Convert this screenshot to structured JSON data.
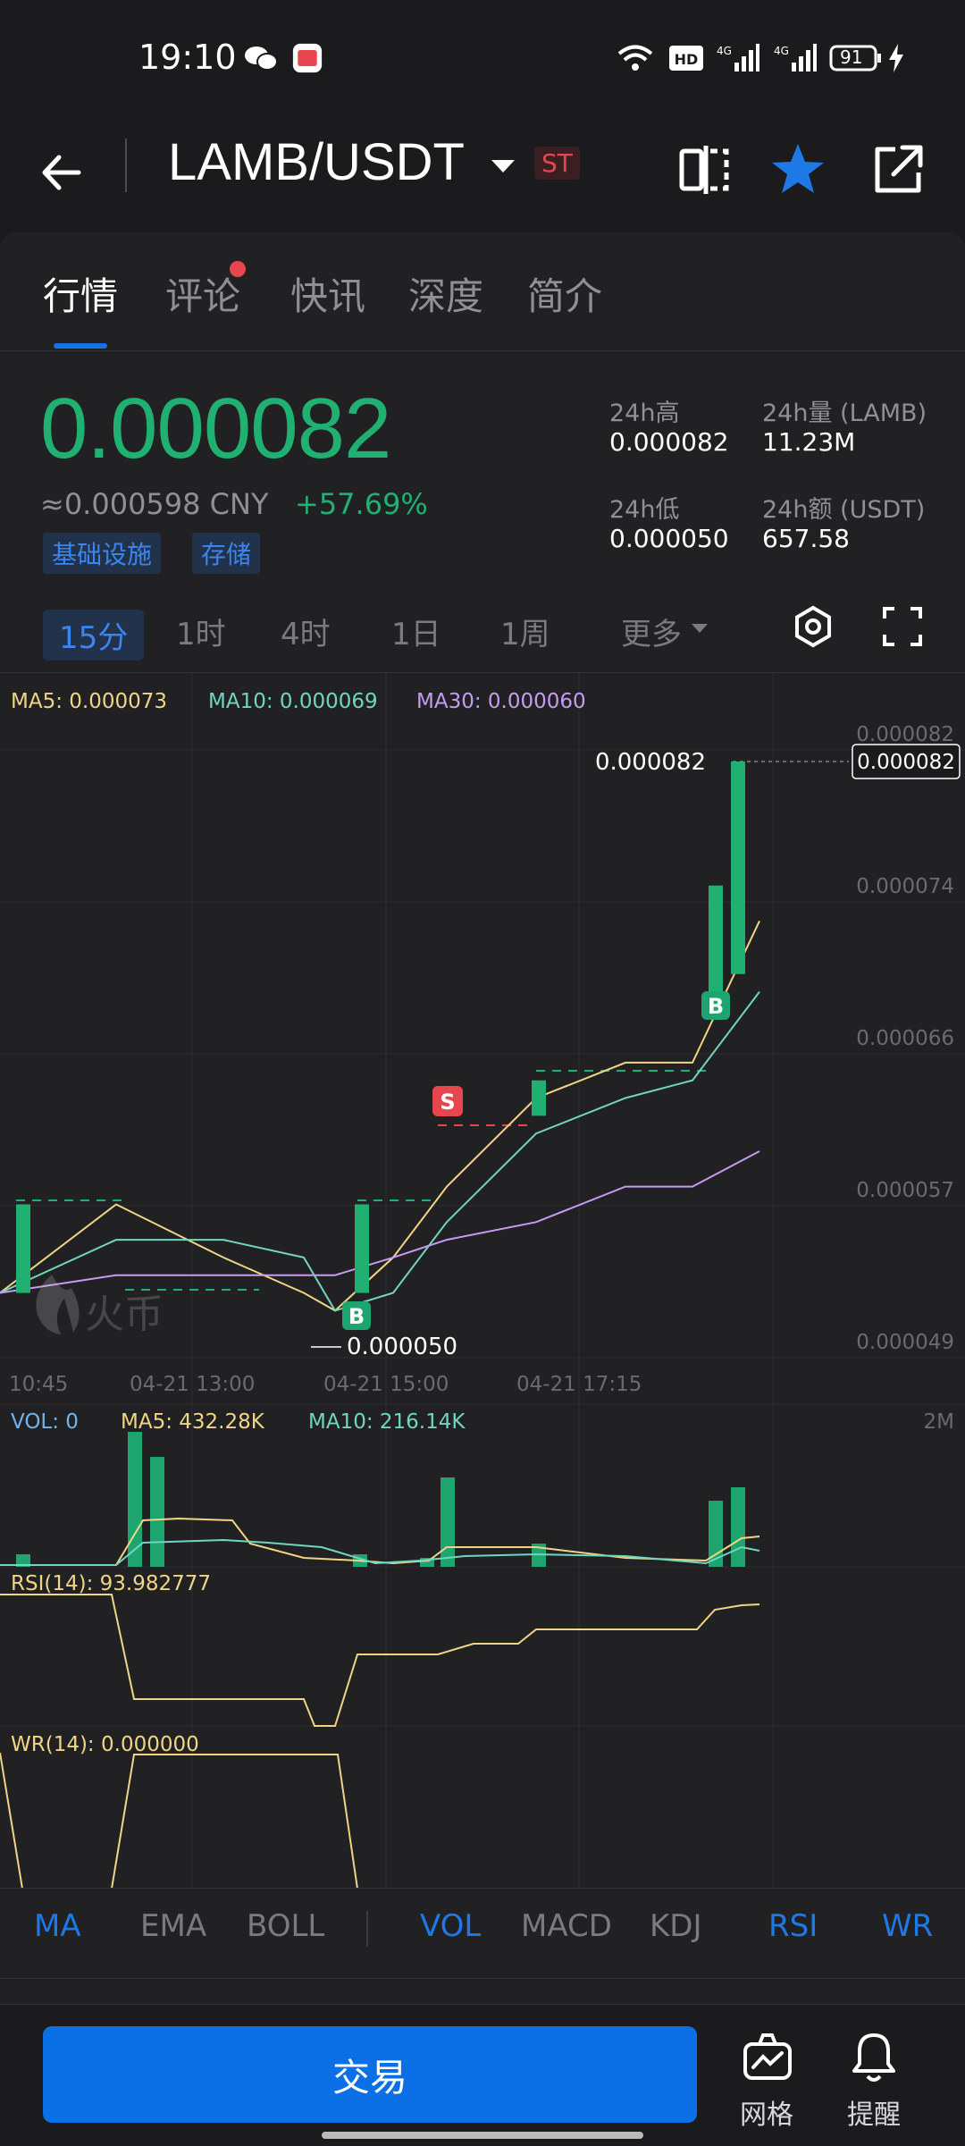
{
  "status_bar": {
    "time": "19:10",
    "battery": "91"
  },
  "header": {
    "pair": "LAMB/USDT",
    "badge": "ST"
  },
  "tabs": [
    "行情",
    "评论",
    "快讯",
    "深度",
    "简介"
  ],
  "ticker": {
    "price": "0.000082",
    "cny": "≈0.000598 CNY",
    "change": "+57.69%",
    "tags": [
      "基础设施",
      "存储"
    ],
    "stats": {
      "high_label": "24h高",
      "high": "0.000082",
      "vol_label": "24h量 (LAMB)",
      "vol": "11.23M",
      "low_label": "24h低",
      "low": "0.000050",
      "amount_label": "24h额 (USDT)",
      "amount": "657.58"
    }
  },
  "timeframes": [
    "15分",
    "1时",
    "4时",
    "1日",
    "1周",
    "更多"
  ],
  "legend": {
    "ma5": "MA5: 0.000073",
    "ma10": "MA10: 0.000069",
    "ma30": "MA30: 0.000060"
  },
  "price_axis": [
    "0.000082",
    "0.000074",
    "0.000066",
    "0.000057",
    "0.000049"
  ],
  "markers": {
    "current": "0.000082",
    "high": "0.000082",
    "low": "0.000050",
    "buy": "B",
    "sell": "S"
  },
  "time_axis": [
    "10:45",
    "04-21 13:00",
    "04-21 15:00",
    "04-21 17:15"
  ],
  "watermark": "火币",
  "vol_legend": {
    "vol": "VOL: 0",
    "ma5": "MA5: 432.28K",
    "ma10": "MA10: 216.14K",
    "max": "2M"
  },
  "rsi_legend": "RSI(14): 93.982777",
  "wr_legend": "WR(14): 0.000000",
  "indicators_main": [
    "MA",
    "EMA",
    "BOLL"
  ],
  "indicators_sub": [
    "VOL",
    "MACD",
    "KDJ",
    "RSI",
    "WR"
  ],
  "bottom": {
    "trade": "交易",
    "grid": "网格",
    "alert": "提醒"
  },
  "colors": {
    "up": "#20b072",
    "down": "#e8464f",
    "accent": "#1670e8",
    "ma5": "#f0d584",
    "ma10": "#6fd6c0",
    "ma30": "#c79bf0"
  },
  "chart_data": {
    "type": "candlestick",
    "candles": [
      {
        "o": 5.2e-05,
        "c": 5.7e-05,
        "h": 5.7e-05,
        "l": 5.2e-05
      },
      {
        "o": 5.2e-05,
        "c": 5.7e-05,
        "h": 5.7e-05,
        "l": 5e-05
      },
      {
        "o": 6.2e-05,
        "c": 6.4e-05,
        "h": 6.4e-05,
        "l": 6.2e-05
      },
      {
        "o": 6.9e-05,
        "c": 7.5e-05,
        "h": 7.5e-05,
        "l": 6.9e-05
      },
      {
        "o": 7e-05,
        "c": 8.2e-05,
        "h": 8.2e-05,
        "l": 7e-05
      }
    ],
    "series": [
      {
        "name": "MA5",
        "values": [
          5.2e-05,
          5.7e-05,
          5.4e-05,
          5.2e-05,
          5.1e-05,
          5.4e-05,
          5.8e-05,
          6.3e-05,
          6.5e-05,
          6.5e-05,
          7.3e-05
        ]
      },
      {
        "name": "MA10",
        "values": [
          5.2e-05,
          5.5e-05,
          5.5e-05,
          5.4e-05,
          5.1e-05,
          5.2e-05,
          5.6e-05,
          6.1e-05,
          6.3e-05,
          6.4e-05,
          6.9e-05
        ]
      },
      {
        "name": "MA30",
        "values": [
          5.2e-05,
          5.3e-05,
          5.3e-05,
          5.3e-05,
          5.3e-05,
          5.4e-05,
          5.5e-05,
          5.6e-05,
          5.8e-05,
          5.8e-05,
          6e-05
        ]
      }
    ],
    "ylim": [
      4.9e-05,
      8.2e-05
    ]
  }
}
